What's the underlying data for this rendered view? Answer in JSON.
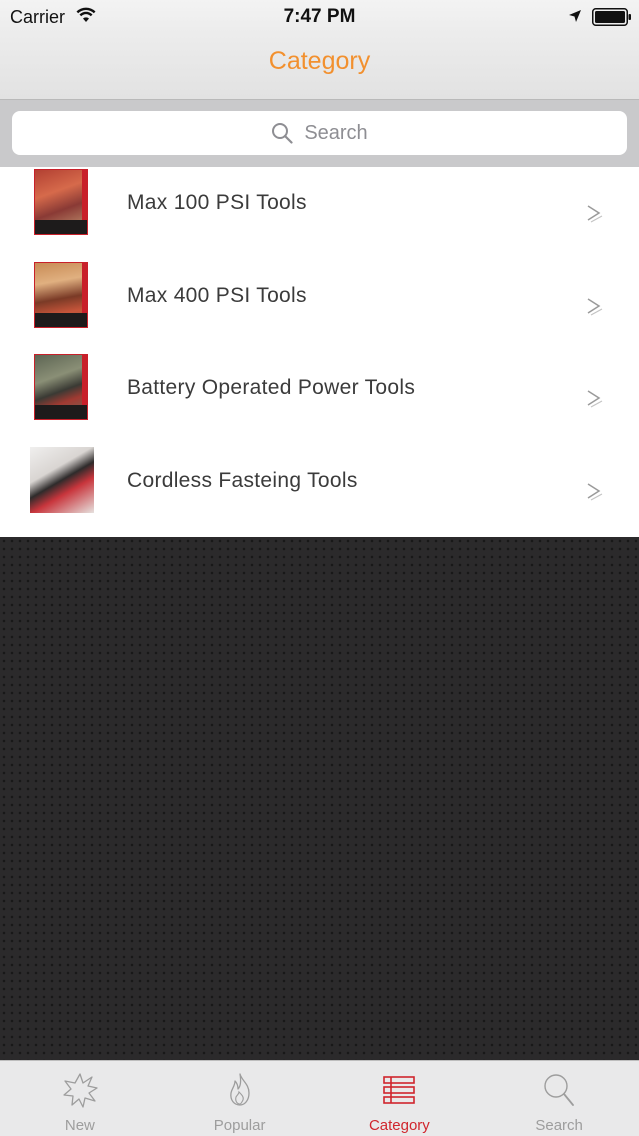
{
  "status_bar": {
    "carrier": "Carrier",
    "time": "7:47 PM"
  },
  "nav": {
    "title": "Category"
  },
  "search": {
    "placeholder": "Search"
  },
  "list": {
    "items": [
      {
        "label": "Max 100 PSI Tools",
        "thumb_caption": "100 PSI PNEUMATIC TOOLS"
      },
      {
        "label": "Max 400 PSI Tools",
        "thumb_caption": "400 PSI HIGH PRESSURE PNEUMATIC SYSTEMS"
      },
      {
        "label": "Battery Operated Power Tools",
        "thumb_caption": "REBAR TYING TOOLS"
      },
      {
        "label": "Cordless Fasteing Tools",
        "thumb_caption": ""
      }
    ]
  },
  "tabs": [
    {
      "label": "New",
      "icon": "starburst-icon"
    },
    {
      "label": "Popular",
      "icon": "flame-icon"
    },
    {
      "label": "Category",
      "icon": "list-icon",
      "active": true
    },
    {
      "label": "Search",
      "icon": "magnifier-icon"
    }
  ],
  "colors": {
    "accent_orange": "#f2902e",
    "active_tab_red": "#d0262d",
    "inactive_tab_gray": "#9d9d9d",
    "backdrop": "#2b2a2b"
  }
}
